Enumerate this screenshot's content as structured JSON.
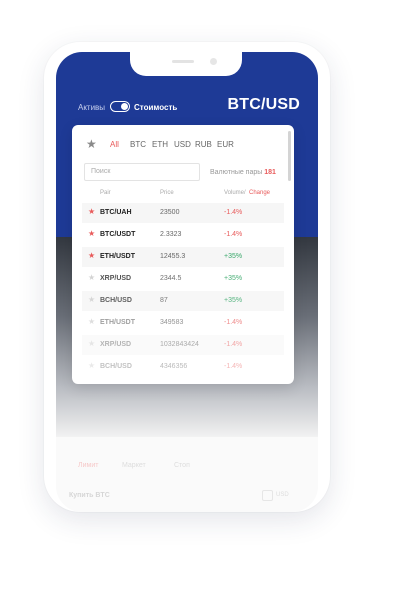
{
  "header": {
    "toggle_left": "Активы",
    "toggle_right": "Стоимость",
    "pair": "BTC/USD"
  },
  "filters": {
    "tabs": [
      "All",
      "BTC",
      "ETH",
      "USD",
      "RUB",
      "EUR"
    ],
    "active": "All"
  },
  "search": {
    "placeholder": "Поиск"
  },
  "pairs_info": {
    "label": "Валютные пары",
    "count": "181"
  },
  "table": {
    "col_pair": "Pair",
    "col_price": "Price",
    "col_volume": "Volume/",
    "col_change": "Change"
  },
  "rows": [
    {
      "pair": "BTC/UAH",
      "price": "23500",
      "change": "-1.4%",
      "starred": true
    },
    {
      "pair": "BTC/USDT",
      "price": "2.3323",
      "change": "-1.4%",
      "starred": true
    },
    {
      "pair": "ETH/USDT",
      "price": "12455.3",
      "change": "+35%",
      "starred": true
    },
    {
      "pair": "XRP/USD",
      "price": "2344.5",
      "change": "+35%",
      "starred": false
    },
    {
      "pair": "BCH/USD",
      "price": "87",
      "change": "+35%",
      "starred": false
    },
    {
      "pair": "ETH/USDT",
      "price": "349583",
      "change": "-1.4%",
      "starred": false
    },
    {
      "pair": "XRP/USD",
      "price": "1032843424",
      "change": "-1.4%",
      "starred": false
    },
    {
      "pair": "BCH/USD",
      "price": "4346356",
      "change": "-1.4%",
      "starred": false
    }
  ],
  "order": {
    "tabs": [
      "Лимит",
      "Маркет",
      "Стоп"
    ],
    "buy_label": "Купить BTC",
    "currency": "USD"
  },
  "colors": {
    "brand_blue": "#1e3a96",
    "accent_red": "#e85a5a",
    "positive_green": "#3aa86b",
    "star_active": "#e85a5a",
    "star_inactive": "#d0d0d0"
  }
}
